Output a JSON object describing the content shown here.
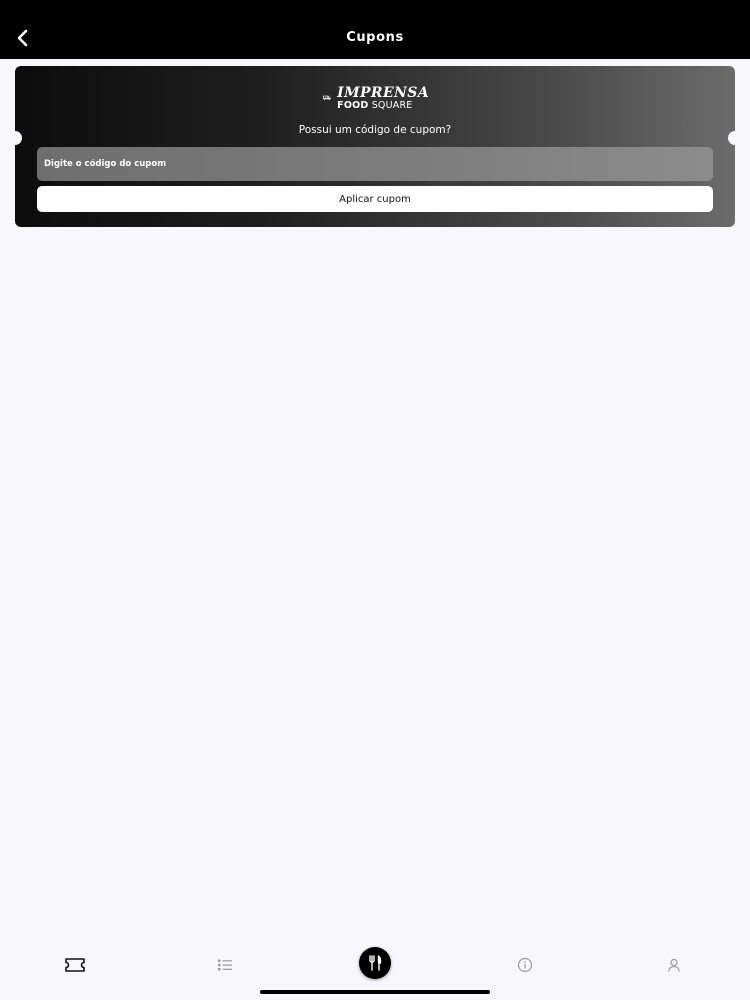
{
  "header": {
    "title": "Cupons",
    "back_icon": "chevron-left-icon"
  },
  "coupon": {
    "logo": {
      "line1": "IMPRENSA",
      "line2_bold": "FOOD",
      "line2_light": "SQUARE",
      "icon": "food-truck-icon"
    },
    "prompt": "Possui um código de cupom?",
    "input": {
      "placeholder": "Digite o código do cupom",
      "value": ""
    },
    "apply_label": "Aplicar cupom"
  },
  "tabbar": {
    "items": [
      {
        "icon": "ticket-icon",
        "active": true
      },
      {
        "icon": "list-icon",
        "active": false
      },
      {
        "icon": "fork-knife-icon",
        "active": false
      },
      {
        "icon": "info-icon",
        "active": false
      },
      {
        "icon": "user-icon",
        "active": false
      }
    ]
  },
  "colors": {
    "header_bg": "#000000",
    "page_bg": "#f8f7fb",
    "card_dark": "#0c0c0c",
    "card_light": "#6b6b6b",
    "button_bg": "#ffffff"
  }
}
